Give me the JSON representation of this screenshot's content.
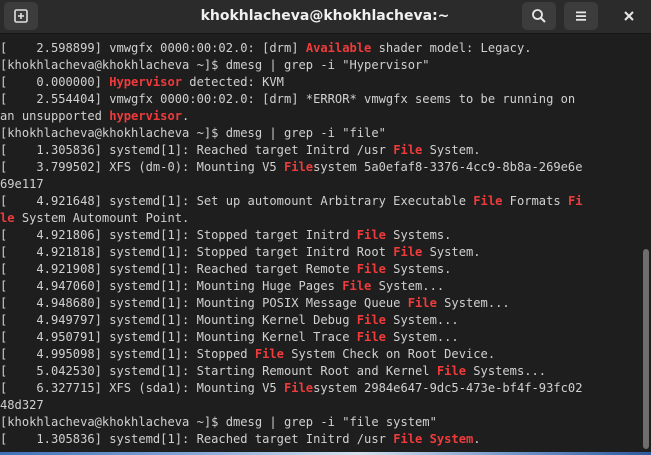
{
  "window": {
    "title": "khokhlacheva@khokhlacheva:~",
    "icons": {
      "new_tab": "new-tab-icon",
      "search": "search-icon",
      "menu": "hamburger-menu-icon",
      "close": "close-icon"
    }
  },
  "colors": {
    "highlight": "#ef3b3b",
    "text": "#d0d0d0",
    "background": "#1e1e1e"
  },
  "terminal": {
    "lines": [
      [
        [
          "[    2.598899] vmwgfx 0000:00:02.0: [drm] ",
          false
        ],
        [
          "Available",
          true
        ],
        [
          " shader model: Legacy.",
          false
        ]
      ],
      [
        [
          "[khokhlacheva@khokhlacheva ~]$ dmesg | grep -i \"Hypervisor\"",
          false
        ]
      ],
      [
        [
          "[    0.000000] ",
          false
        ],
        [
          "Hypervisor",
          true
        ],
        [
          " detected: KVM",
          false
        ]
      ],
      [
        [
          "[    2.554404] vmwgfx 0000:00:02.0: [drm] *ERROR* vmwgfx seems to be running on",
          false
        ]
      ],
      [
        [
          "an unsupported ",
          false
        ],
        [
          "hypervisor",
          true
        ],
        [
          ".",
          false
        ]
      ],
      [
        [
          "[khokhlacheva@khokhlacheva ~]$ dmesg | grep -i \"file\"",
          false
        ]
      ],
      [
        [
          "[    1.305836] systemd[1]: Reached target Initrd /usr ",
          false
        ],
        [
          "File",
          true
        ],
        [
          " System.",
          false
        ]
      ],
      [
        [
          "[    3.799502] XFS (dm-0): Mounting V5 ",
          false
        ],
        [
          "File",
          true
        ],
        [
          "system 5a0efaf8-3376-4cc9-8b8a-269e6e",
          false
        ]
      ],
      [
        [
          "69e117",
          false
        ]
      ],
      [
        [
          "[    4.921648] systemd[1]: Set up automount Arbitrary Executable ",
          false
        ],
        [
          "File",
          true
        ],
        [
          " Formats ",
          false
        ],
        [
          "Fi",
          true
        ]
      ],
      [
        [
          "le",
          true
        ],
        [
          " System Automount Point.",
          false
        ]
      ],
      [
        [
          "[    4.921806] systemd[1]: Stopped target Initrd ",
          false
        ],
        [
          "File",
          true
        ],
        [
          " Systems.",
          false
        ]
      ],
      [
        [
          "[    4.921818] systemd[1]: Stopped target Initrd Root ",
          false
        ],
        [
          "File",
          true
        ],
        [
          " System.",
          false
        ]
      ],
      [
        [
          "[    4.921908] systemd[1]: Reached target Remote ",
          false
        ],
        [
          "File",
          true
        ],
        [
          " Systems.",
          false
        ]
      ],
      [
        [
          "[    4.947060] systemd[1]: Mounting Huge Pages ",
          false
        ],
        [
          "File",
          true
        ],
        [
          " System...",
          false
        ]
      ],
      [
        [
          "[    4.948680] systemd[1]: Mounting POSIX Message Queue ",
          false
        ],
        [
          "File",
          true
        ],
        [
          " System...",
          false
        ]
      ],
      [
        [
          "[    4.949797] systemd[1]: Mounting Kernel Debug ",
          false
        ],
        [
          "File",
          true
        ],
        [
          " System...",
          false
        ]
      ],
      [
        [
          "[    4.950791] systemd[1]: Mounting Kernel Trace ",
          false
        ],
        [
          "File",
          true
        ],
        [
          " System...",
          false
        ]
      ],
      [
        [
          "[    4.995098] systemd[1]: Stopped ",
          false
        ],
        [
          "File",
          true
        ],
        [
          " System Check on Root Device.",
          false
        ]
      ],
      [
        [
          "[    5.042530] systemd[1]: Starting Remount Root and Kernel ",
          false
        ],
        [
          "File",
          true
        ],
        [
          " Systems...",
          false
        ]
      ],
      [
        [
          "[    6.327715] XFS (sda1): Mounting V5 ",
          false
        ],
        [
          "File",
          true
        ],
        [
          "system 2984e647-9dc5-473e-bf4f-93fc02",
          false
        ]
      ],
      [
        [
          "48d327",
          false
        ]
      ],
      [
        [
          "[khokhlacheva@khokhlacheva ~]$ dmesg | grep -i \"file system\"",
          false
        ]
      ],
      [
        [
          "[    1.305836] systemd[1]: Reached target Initrd /usr ",
          false
        ],
        [
          "File System",
          true
        ],
        [
          ".",
          false
        ]
      ]
    ]
  }
}
